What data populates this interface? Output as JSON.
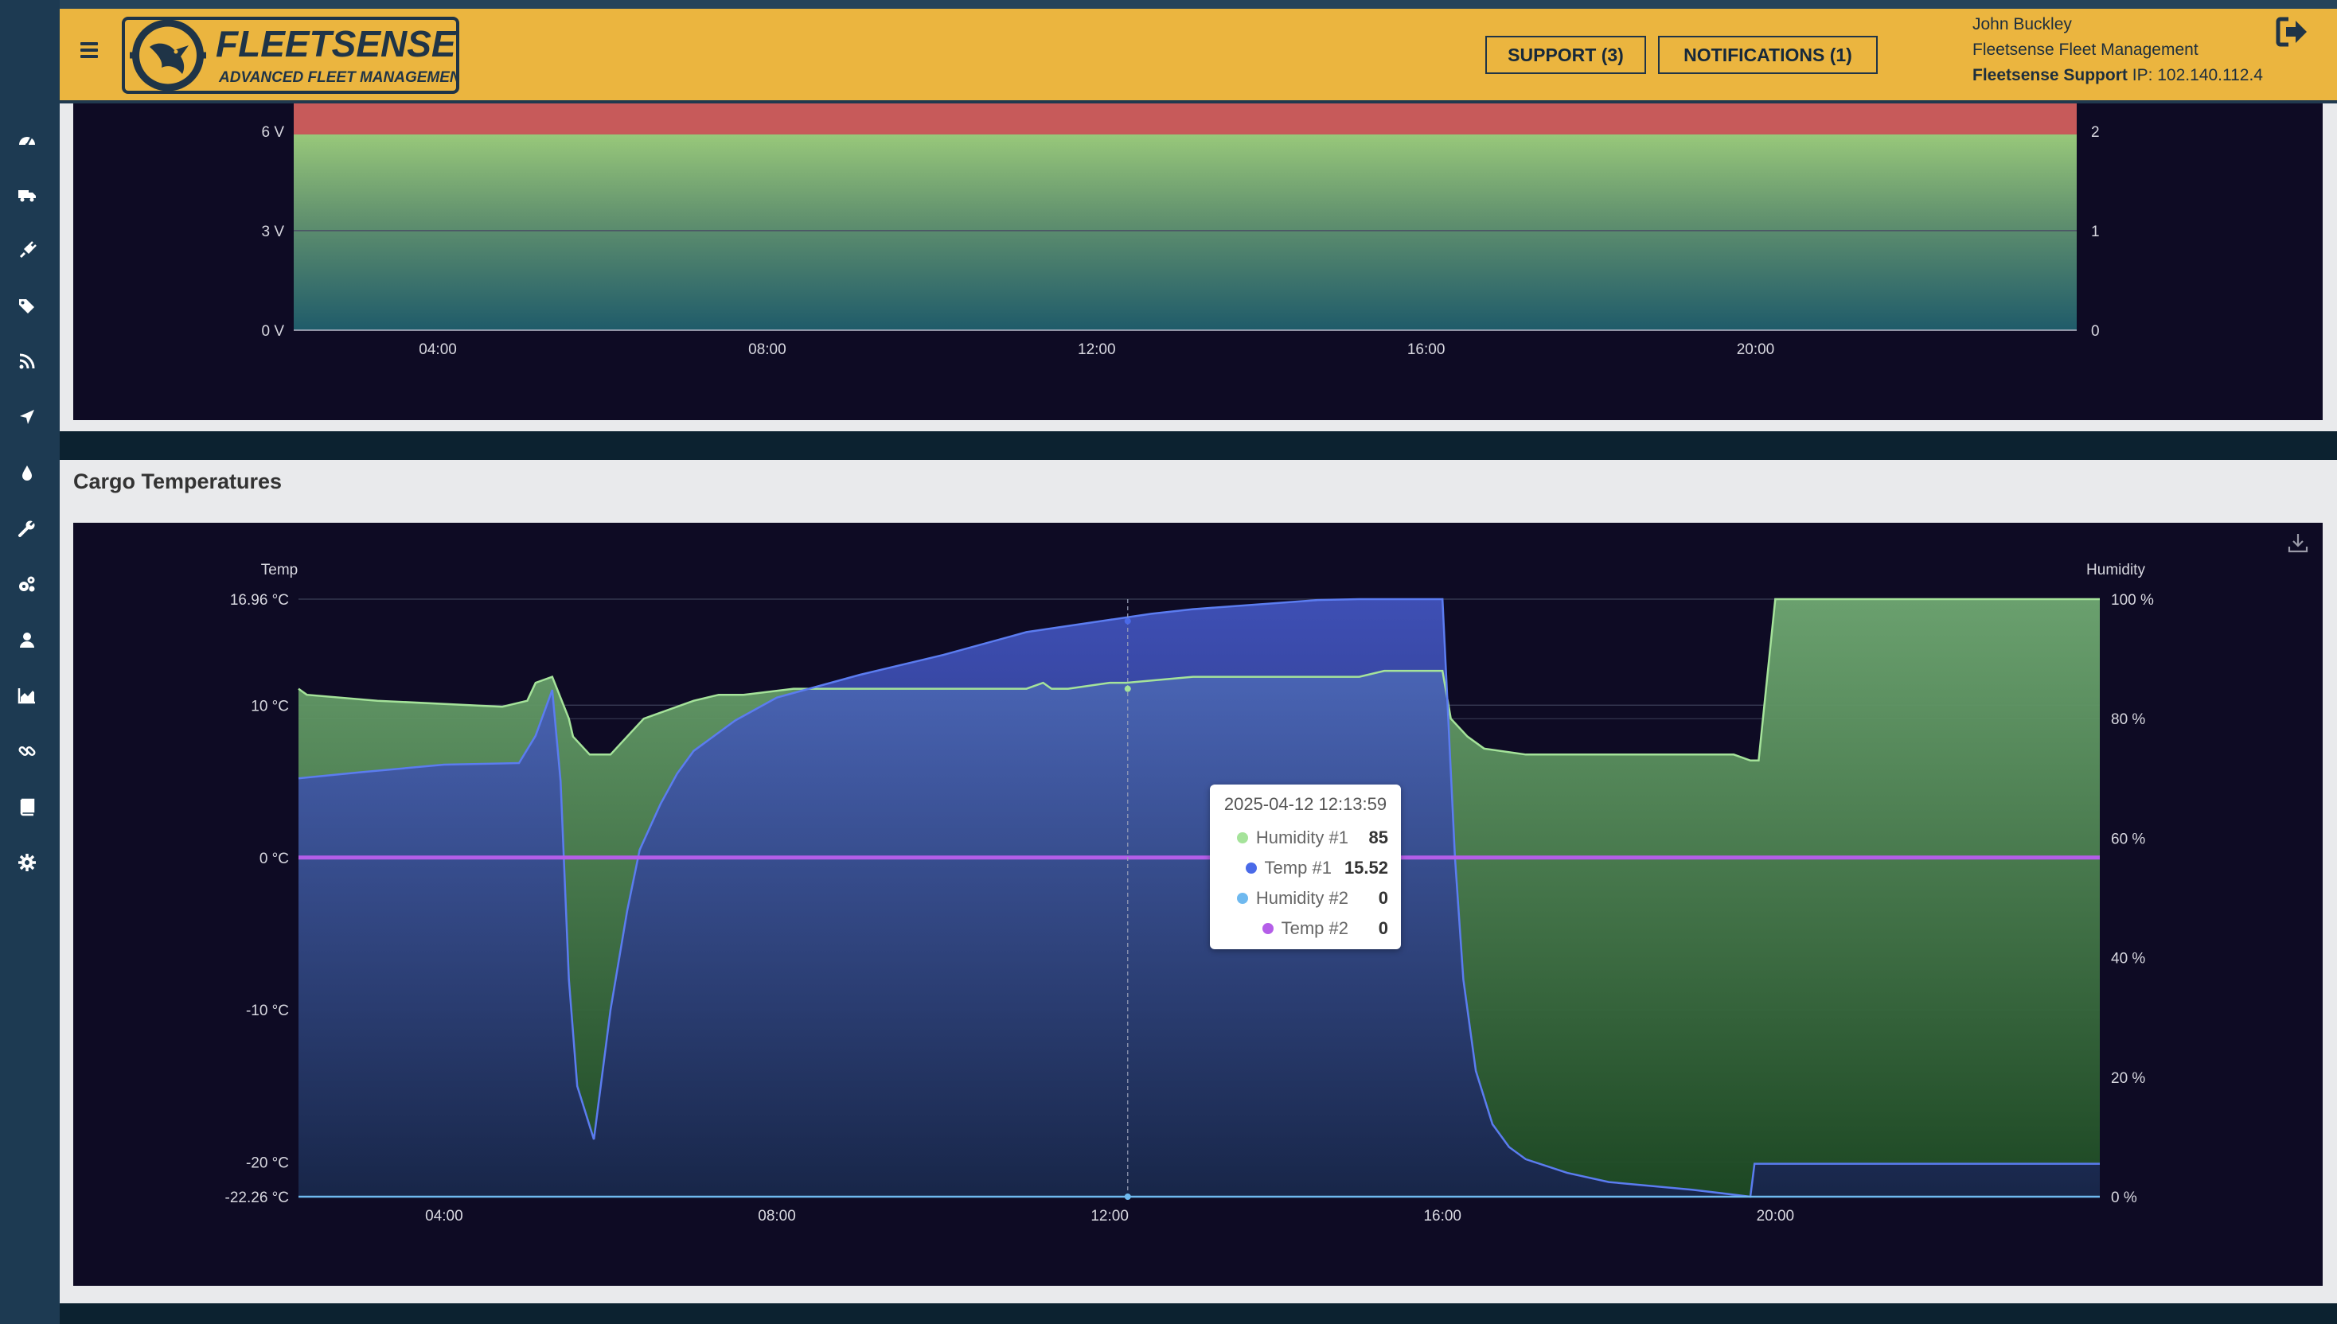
{
  "app": {
    "brand_name": "FLEETSENSE",
    "brand_tagline": "ADVANCED FLEET MANAGEMENT"
  },
  "header": {
    "support_label": "SUPPORT (3)",
    "notifications_label": "NOTIFICATIONS (1)",
    "user_name": "John Buckley",
    "organization": "Fleetsense Fleet Management",
    "support_org": "Fleetsense Support",
    "ip_text": "IP: 102.140.112.4"
  },
  "sidebar": {
    "icons": [
      "dashboard-icon",
      "truck-icon",
      "plug-icon",
      "tags-icon",
      "rss-icon",
      "location-arrow-icon",
      "drop-icon",
      "wrench-icon",
      "gears-icon",
      "user-icon",
      "area-chart-icon",
      "link-icon",
      "book-icon",
      "gear-icon"
    ]
  },
  "colors": {
    "header_bg": "#ebb53f",
    "sidebar_bg": "#1d3a52",
    "chart_bg": "#0e0b24",
    "humidity1": "#a5e39a",
    "temp1": "#4a6ae8",
    "humidity2": "#6fb9ef",
    "temp2": "#b45ee8",
    "voltage_danger": "#c75a5a"
  },
  "cargo_panel": {
    "title": "Cargo Temperatures"
  },
  "tooltip": {
    "date": "2025-04-12 12:13:59",
    "rows": [
      {
        "name": "Humidity #1",
        "value": "85"
      },
      {
        "name": "Temp #1",
        "value": "15.52"
      },
      {
        "name": "Humidity #2",
        "value": "0"
      },
      {
        "name": "Temp #2",
        "value": "0"
      }
    ]
  },
  "chart_data": [
    {
      "type": "area",
      "title": "",
      "y_ticks": [
        "6 V",
        "3 V",
        "0 V"
      ],
      "y2_ticks": [
        "2",
        "1",
        "0"
      ],
      "x_ticks": [
        "04:00",
        "08:00",
        "12:00",
        "16:00",
        "20:00"
      ],
      "ylim": [
        0,
        6.5
      ],
      "danger_band": [
        5.9,
        6.5
      ],
      "grid": true
    },
    {
      "type": "area",
      "title": "",
      "ylabel": "Temp",
      "y2label": "Humidity",
      "x_ticks": [
        "04:00",
        "08:00",
        "12:00",
        "16:00",
        "20:00"
      ],
      "y_ticks": [
        "16.96 °C",
        "10 °C",
        "0 °C",
        "-10 °C",
        "-20 °C",
        "-22.26 °C"
      ],
      "y2_ticks": [
        "100 %",
        "80 %",
        "60 %",
        "40 %",
        "20 %",
        "0 %"
      ],
      "ylim": [
        -22.26,
        16.96
      ],
      "y2lim": [
        0,
        100
      ],
      "xlim_hours": [
        2.25,
        23.9
      ],
      "legend": "tooltip",
      "grid": true,
      "series": [
        {
          "name": "Humidity #1",
          "axis": "y2",
          "x": [
            2.25,
            2.35,
            3.2,
            4.7,
            5.0,
            5.1,
            5.3,
            5.5,
            5.55,
            5.75,
            6.0,
            6.2,
            6.4,
            6.6,
            6.8,
            7.0,
            7.3,
            7.6,
            8.2,
            9.0,
            10.0,
            11.0,
            11.2,
            11.3,
            11.5,
            12.0,
            12.2,
            13.0,
            14.5,
            15.0,
            15.3,
            16.0,
            16.1,
            16.3,
            16.5,
            17.0,
            18.0,
            19.0,
            19.5,
            19.7,
            19.8,
            20.0,
            23.9
          ],
          "y": [
            85,
            84,
            83,
            82,
            83,
            86,
            87,
            80,
            77,
            74,
            74,
            77,
            80,
            81,
            82,
            83,
            84,
            84,
            85,
            85,
            85,
            85,
            86,
            85,
            85,
            86,
            86,
            87,
            87,
            87,
            88,
            88,
            80,
            77,
            75,
            74,
            74,
            74,
            74,
            73,
            73,
            100,
            100
          ]
        },
        {
          "name": "Temp #1",
          "axis": "y",
          "x": [
            2.25,
            3.0,
            4.0,
            4.9,
            5.1,
            5.3,
            5.4,
            5.5,
            5.6,
            5.8,
            6.0,
            6.2,
            6.35,
            6.6,
            6.8,
            7.0,
            7.5,
            8.0,
            9.0,
            10.0,
            11.0,
            12.0,
            12.5,
            13.0,
            14.0,
            14.5,
            15.0,
            15.7,
            16.0,
            16.15,
            16.25,
            16.4,
            16.6,
            16.8,
            17.0,
            17.5,
            18.0,
            19.0,
            19.7,
            19.75,
            23.9
          ],
          "y": [
            5.2,
            5.6,
            6.1,
            6.2,
            8.0,
            11.0,
            5.0,
            -8.0,
            -15.0,
            -18.5,
            -10.0,
            -3.5,
            0.5,
            3.5,
            5.5,
            7.0,
            9.0,
            10.5,
            12.0,
            13.3,
            14.8,
            15.6,
            16.0,
            16.3,
            16.7,
            16.9,
            16.96,
            16.96,
            16.96,
            0.0,
            -8.0,
            -14.0,
            -17.5,
            -19.0,
            -19.8,
            -20.7,
            -21.3,
            -21.8,
            -22.26,
            -20.1,
            -20.1
          ]
        },
        {
          "name": "Humidity #2",
          "axis": "y2",
          "x": [
            2.25,
            23.9
          ],
          "y": [
            0,
            0
          ]
        },
        {
          "name": "Temp #2",
          "axis": "y",
          "x": [
            2.25,
            23.9
          ],
          "y": [
            0,
            0
          ]
        }
      ],
      "crosshair_time": "12:13"
    }
  ]
}
